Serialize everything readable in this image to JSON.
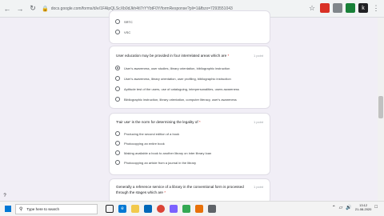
{
  "browser": {
    "url": "docs.google.com/forms/d/e/1FAIpQLScXb0dJkh4tI7rYYbtF0Y/formResponse?pli=1&fbzx=7293551043"
  },
  "questions": [
    {
      "options": [
        {
          "label": "SRTC",
          "checked": false
        },
        {
          "label": "VSC",
          "checked": false
        }
      ]
    },
    {
      "title": "User education may be provided in four interrelated areas which are",
      "required_mark": "*",
      "points": "1 point",
      "options": [
        {
          "label": "User's awareness, user studies, library orientation, bibliographic instruction",
          "checked": true
        },
        {
          "label": "User's awareness, library orientation, user profiling, bibliographic instruction",
          "checked": false
        },
        {
          "label": "Aptitude test of the users, use of cataloguing, interpersonalities, users awareness",
          "checked": false
        },
        {
          "label": "Bibliographic instruction, library orientation, computer literacy, user's awareness",
          "checked": false
        }
      ]
    },
    {
      "title": "'Fair use' is the norm for determining the legality of",
      "required_mark": "*",
      "points": "1 point",
      "options": [
        {
          "label": "Producing the second edition of a book",
          "checked": false
        },
        {
          "label": "Photocopying an entire book",
          "checked": false
        },
        {
          "label": "Making available a book to another library on inter library loan",
          "checked": false
        },
        {
          "label": "Photocopying an article from a journal in the library",
          "checked": false
        }
      ]
    },
    {
      "title": "Generally a reference service of a library in the conventional form is processed through the stages which are",
      "required_mark": "*",
      "points": "1 point"
    }
  ],
  "taskbar": {
    "search_placeholder": "Type here to search",
    "time": "13:12",
    "date": "21-08-2020"
  },
  "colors": {
    "page_bg": "#f1eef6",
    "accent": "#5f6368"
  }
}
